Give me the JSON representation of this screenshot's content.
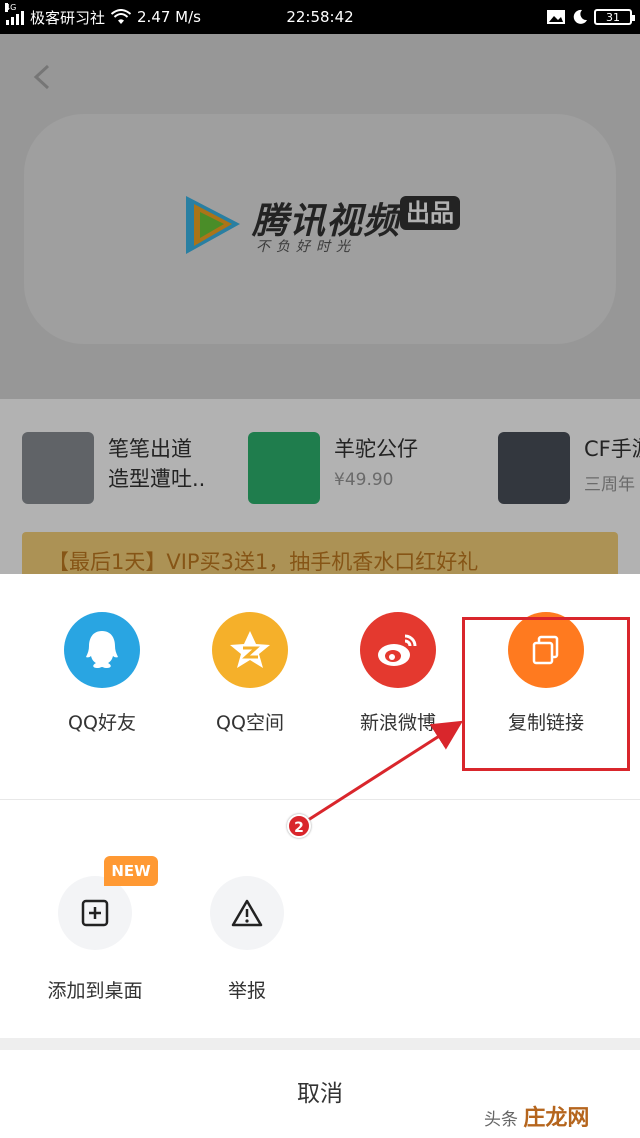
{
  "status_bar": {
    "network": "4G",
    "carrier": "极客研习社",
    "speed": "2.47 M/s",
    "time": "22:58:42",
    "battery": "31"
  },
  "background_page": {
    "logo_text": "腾讯视频",
    "logo_badge": "出品",
    "logo_slogan": "不负好时光",
    "products": [
      {
        "title_line1": "笔笔出道",
        "title_line2": "造型遭吐..",
        "price": ""
      },
      {
        "title_line1": "羊驼公仔",
        "title_line2": "",
        "price": "¥49.90"
      },
      {
        "title_line1": "CF手游",
        "title_line2": "",
        "price": "三周年"
      }
    ],
    "promo": "【最后1天】VIP买3送1，抽手机香水口红好礼"
  },
  "share_sheet": {
    "share_targets": [
      {
        "label": "QQ好友",
        "icon": "qq-icon",
        "color": "#29a5e2"
      },
      {
        "label": "QQ空间",
        "icon": "qzone-icon",
        "color": "#f5b02a"
      },
      {
        "label": "新浪微博",
        "icon": "weibo-icon",
        "color": "#e4392f"
      },
      {
        "label": "复制链接",
        "icon": "copy-link-icon",
        "color": "#ff7a1f"
      }
    ],
    "tools": [
      {
        "label": "添加到桌面",
        "icon": "add-to-desktop-icon",
        "badge": "NEW"
      },
      {
        "label": "举报",
        "icon": "report-icon",
        "badge": ""
      }
    ],
    "cancel_label": "取消"
  },
  "annotation": {
    "step": "2",
    "color": "#d9262c"
  },
  "watermark": {
    "prefix": "头条",
    "brand": "庄龙网"
  }
}
